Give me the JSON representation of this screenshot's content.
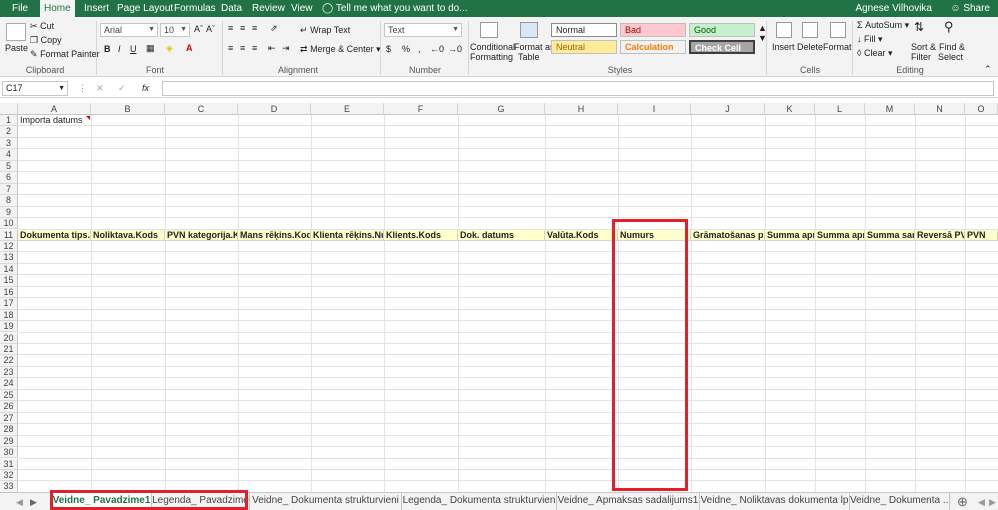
{
  "menu_tabs": [
    "File",
    "Home",
    "Insert",
    "Page Layout",
    "Formulas",
    "Data",
    "Review",
    "View"
  ],
  "active_tab": "Home",
  "tell_me": "Tell me what you want to do...",
  "user_name": "Agnese Vilhovika",
  "share_label": "Share",
  "ribbon": {
    "clipboard": {
      "paste": "Paste",
      "cut": "Cut",
      "copy": "Copy",
      "format_painter": "Format Painter",
      "label": "Clipboard"
    },
    "font": {
      "name": "Arial",
      "size": "10",
      "bold": "B",
      "italic": "I",
      "underline": "U",
      "label": "Font"
    },
    "alignment": {
      "wrap_text": "Wrap Text",
      "merge_center": "Merge & Center",
      "label": "Alignment"
    },
    "number": {
      "format": "Text",
      "currency": "$",
      "percent": "%",
      "comma": ",",
      "label": "Number"
    },
    "styles": {
      "conditional": "Conditional",
      "formatting": "Formatting",
      "format_as": "Format as",
      "table": "Table",
      "normal": "Normal",
      "bad": "Bad",
      "good": "Good",
      "neutral": "Neutral",
      "calculation": "Calculation",
      "check_cell": "Check Cell",
      "label": "Styles"
    },
    "cells": {
      "insert": "Insert",
      "delete": "Delete",
      "format": "Format",
      "label": "Cells"
    },
    "editing": {
      "autosum": "AutoSum",
      "fill": "Fill",
      "clear": "Clear",
      "sort_filter": "Sort &",
      "sort_filter2": "Filter",
      "find_select": "Find &",
      "find_select2": "Select",
      "label": "Editing"
    }
  },
  "name_box": "C17",
  "fx": "fx",
  "columns": [
    "A",
    "B",
    "C",
    "D",
    "E",
    "F",
    "G",
    "H",
    "I",
    "J",
    "K",
    "L",
    "M",
    "N",
    "O"
  ],
  "rows": [
    "1",
    "2",
    "3",
    "4",
    "5",
    "6",
    "7",
    "8",
    "9",
    "10",
    "11",
    "12",
    "13",
    "14",
    "15",
    "16",
    "17",
    "18",
    "19",
    "20",
    "21",
    "22",
    "23",
    "24",
    "25",
    "26",
    "27",
    "28",
    "29",
    "30",
    "31",
    "32",
    "33"
  ],
  "cells": {
    "a1": "Importa datums",
    "row11": [
      "Dokumenta tips.K",
      "Noliktava.Kods",
      "PVN kategorija.Ko",
      "Mans rēķins.Kods",
      "Klienta rēķins.Nu",
      "Klients.Kods",
      "Dok. datums",
      "Valūta.Kods",
      "Numurs",
      "Grāmatošanas pie",
      "Summa apm",
      "Summa apm",
      "Summa sam",
      "Reversā PV",
      "PVN"
    ]
  },
  "sheets": [
    "Veidne_ Pavadzime1",
    "Legenda_ Pavadzime",
    "Veidne_ Dokumenta strukturvieni",
    "Legenda_ Dokumenta strukturvien",
    "Veidne_ Apmaksas sadalijums1",
    "Veidne_ Noliktavas dokumenta lp",
    "Veidne_ Dokumenta ..."
  ],
  "active_sheet": "Veidne_ Pavadzime1",
  "colors": {
    "excel_green": "#217346",
    "header_fill": "#ffffcc",
    "highlight": "#e0202a"
  }
}
